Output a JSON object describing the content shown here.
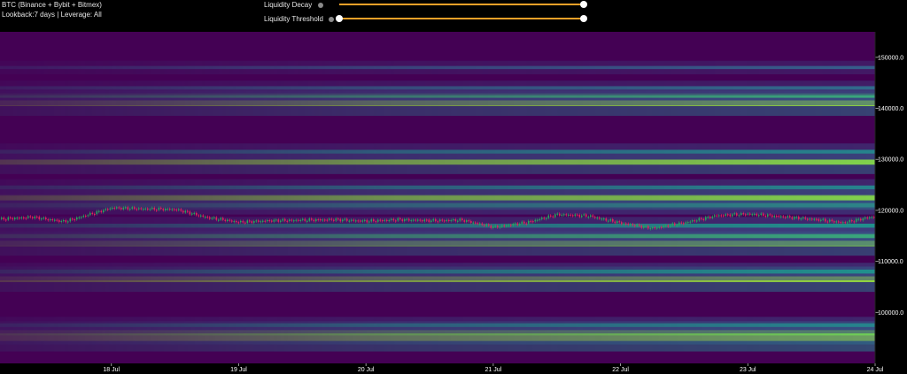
{
  "header": {
    "title": "BTC (Binance + Bybit + Bitmex)",
    "subtitle": "Lookback:7 days | Leverage: All"
  },
  "controls": {
    "decay": {
      "label": "Liquidity Decay",
      "value": 1.0
    },
    "threshold": {
      "label": "Liquidity Threshold",
      "range": [
        0.0,
        1.0
      ]
    }
  },
  "colors": {
    "background": "#000000",
    "heatmap_low": "#440154",
    "heatmap_mid": "#21908d",
    "heatmap_high": "#b5de2b",
    "slider_track": "#f0a028",
    "candle_up": "#26a65b",
    "candle_down": "#e0245e"
  },
  "chart_data": {
    "type": "heatmap",
    "title": "",
    "xlabel": "",
    "ylabel": "",
    "x_ticks": [
      "18 Jul",
      "19 Jul",
      "20 Jul",
      "21 Jul",
      "22 Jul",
      "23 Jul",
      "24 Jul"
    ],
    "y_ticks": [
      "100000.0",
      "110000.0",
      "120000.0",
      "130000.0",
      "140000.0",
      "150000.0"
    ],
    "y_tick_values": [
      100000,
      110000,
      120000,
      130000,
      140000,
      150000
    ],
    "x_range": [
      "2025-07-17 03:00",
      "2025-07-24 00:00"
    ],
    "ylim": [
      90000,
      155000
    ],
    "liquidity_bands": [
      {
        "price": 95000,
        "intensity": 1.0
      },
      {
        "price": 96000,
        "intensity": 0.8
      },
      {
        "price": 97500,
        "intensity": 0.45
      },
      {
        "price": 106500,
        "intensity": 0.9
      },
      {
        "price": 108000,
        "intensity": 0.5
      },
      {
        "price": 113500,
        "intensity": 0.85
      },
      {
        "price": 115000,
        "intensity": 0.6
      },
      {
        "price": 117000,
        "intensity": 0.5
      },
      {
        "price": 121000,
        "intensity": 0.55
      },
      {
        "price": 122500,
        "intensity": 0.85
      },
      {
        "price": 124500,
        "intensity": 0.45
      },
      {
        "price": 129500,
        "intensity": 0.85
      },
      {
        "price": 131500,
        "intensity": 0.45
      },
      {
        "price": 141000,
        "intensity": 0.9
      },
      {
        "price": 142500,
        "intensity": 0.6
      },
      {
        "price": 144000,
        "intensity": 0.35
      },
      {
        "price": 148000,
        "intensity": 0.3
      }
    ],
    "price_series": {
      "name": "",
      "points": [
        [
          "2025-07-17 03:00",
          118300
        ],
        [
          "2025-07-17 09:00",
          118700
        ],
        [
          "2025-07-17 15:00",
          117800
        ],
        [
          "2025-07-17 21:00",
          119600
        ],
        [
          "2025-07-18 00:00",
          120500
        ],
        [
          "2025-07-18 06:00",
          120300
        ],
        [
          "2025-07-18 12:00",
          120200
        ],
        [
          "2025-07-18 18:00",
          118600
        ],
        [
          "2025-07-19 00:00",
          117700
        ],
        [
          "2025-07-19 06:00",
          118000
        ],
        [
          "2025-07-19 12:00",
          118100
        ],
        [
          "2025-07-19 18:00",
          118200
        ],
        [
          "2025-07-20 00:00",
          117900
        ],
        [
          "2025-07-20 06:00",
          118200
        ],
        [
          "2025-07-20 12:00",
          118000
        ],
        [
          "2025-07-20 18:00",
          118100
        ],
        [
          "2025-07-21 00:00",
          116700
        ],
        [
          "2025-07-21 06:00",
          117600
        ],
        [
          "2025-07-21 12:00",
          119200
        ],
        [
          "2025-07-21 18:00",
          118900
        ],
        [
          "2025-07-22 00:00",
          117500
        ],
        [
          "2025-07-22 06:00",
          116500
        ],
        [
          "2025-07-22 12:00",
          117600
        ],
        [
          "2025-07-22 18:00",
          119000
        ],
        [
          "2025-07-23 00:00",
          119300
        ],
        [
          "2025-07-23 06:00",
          118800
        ],
        [
          "2025-07-23 12:00",
          118300
        ],
        [
          "2025-07-23 18:00",
          117600
        ],
        [
          "2025-07-24 00:00",
          118900
        ]
      ]
    }
  }
}
